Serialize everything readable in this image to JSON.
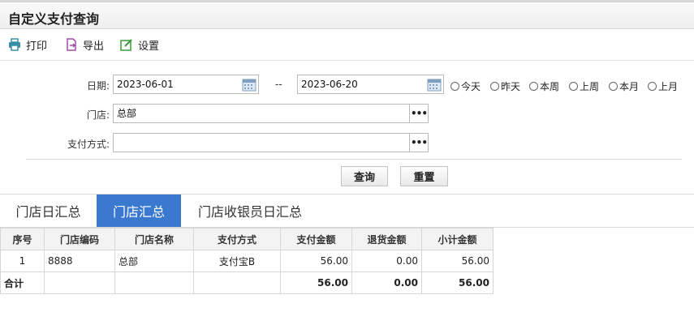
{
  "page": {
    "title": "自定义支付查询"
  },
  "toolbar": {
    "print": "打印",
    "export": "导出",
    "settings": "设置"
  },
  "filters": {
    "date_label": "日期:",
    "date_from": "2023-06-01",
    "date_sep": "--",
    "date_to": "2023-06-20",
    "quick_ranges": [
      "今天",
      "昨天",
      "本周",
      "上周",
      "本月",
      "上月"
    ],
    "store_label": "门店:",
    "store_value": "总部",
    "pay_label": "支付方式:",
    "pay_value": "",
    "dots": "•••"
  },
  "buttons": {
    "query": "查询",
    "reset": "重置"
  },
  "tabs": [
    {
      "label": "门店日汇总",
      "active": false
    },
    {
      "label": "门店汇总",
      "active": true
    },
    {
      "label": "门店收银员日汇总",
      "active": false
    }
  ],
  "table": {
    "columns": [
      "序号",
      "门店编码",
      "门店名称",
      "支付方式",
      "支付金额",
      "退货金额",
      "小计金额"
    ],
    "rows": [
      [
        "1",
        "8888",
        "总部",
        "支付宝B",
        "56.00",
        "0.00",
        "56.00"
      ]
    ],
    "total": [
      "合计",
      "",
      "",
      "",
      "56.00",
      "0.00",
      "56.00"
    ]
  },
  "colors": {
    "tab_active": "#3b79d0",
    "print_icon": "#3a8fa8",
    "export_icon": "#a24aa8",
    "settings_icon": "#3a9a3a"
  }
}
